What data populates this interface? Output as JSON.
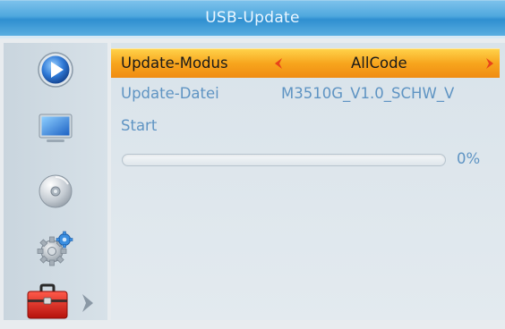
{
  "header": {
    "title": "USB-Update"
  },
  "sidebar": {
    "items": [
      {
        "name": "media-player",
        "icon": "play-icon",
        "selected": false
      },
      {
        "name": "picture",
        "icon": "tv-icon",
        "selected": false
      },
      {
        "name": "disc",
        "icon": "disc-icon",
        "selected": false
      },
      {
        "name": "settings",
        "icon": "gear-icon",
        "selected": false
      },
      {
        "name": "tools",
        "icon": "toolbox-icon",
        "selected": true
      }
    ]
  },
  "main": {
    "rows": [
      {
        "label": "Update-Modus",
        "value": "AllCode",
        "selected": true
      },
      {
        "label": "Update-Datei",
        "value": "M3510G_V1.0_SCHW_V",
        "selected": false
      },
      {
        "label": "Start",
        "value": "",
        "selected": false
      }
    ],
    "progress": {
      "percent_text": "0%",
      "value": 0
    }
  },
  "colors": {
    "title_bar": "#4fa8de",
    "highlight": "#f7a51d",
    "text": "#5f94c3",
    "chevron": "#e8431a"
  }
}
